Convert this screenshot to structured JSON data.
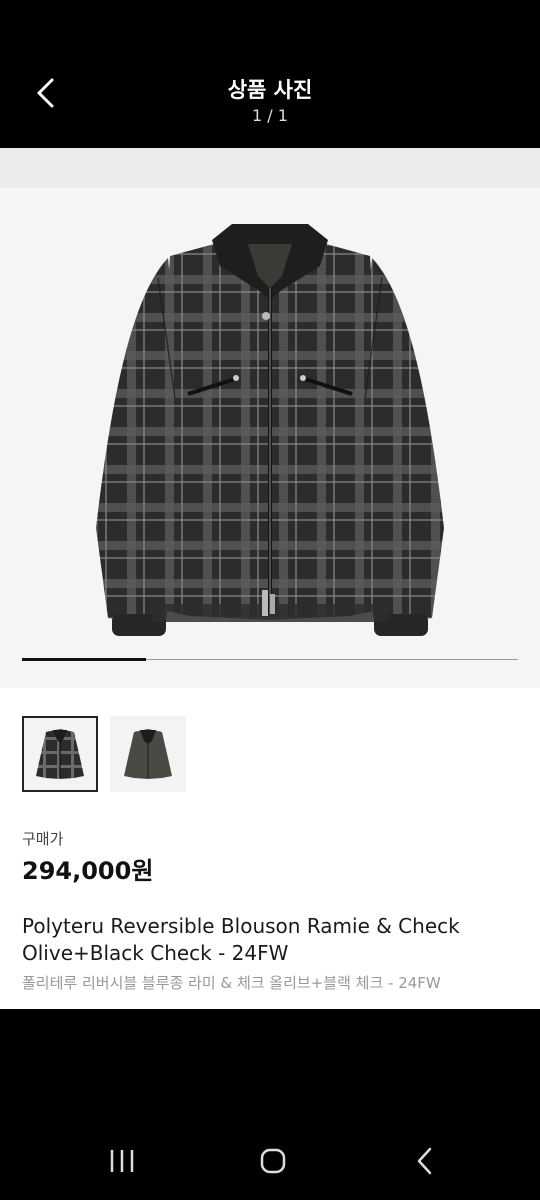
{
  "header": {
    "title": "상품 사진",
    "counter": "1 / 1"
  },
  "gallery": {
    "progress": 0.25
  },
  "thumbnails": [
    {
      "name": "plaid-jacket-thumbnail"
    },
    {
      "name": "olive-jacket-thumbnail"
    }
  ],
  "product": {
    "price_label": "구매가",
    "price": "294,000원",
    "name_en": "Polyteru Reversible Blouson Ramie & Check Olive+Black Check - 24FW",
    "name_ko": "폴리테루 리버시블 블루종 라미 & 체크 올리브+블랙 체크 - 24FW"
  },
  "colors": {
    "accent": "#111111",
    "muted": "#999999",
    "jacket_dark": "#2a2a2a",
    "jacket_grey": "#6a6a6a",
    "olive": "#4a4a44"
  },
  "system_nav": {
    "icons": [
      "recent-apps-icon",
      "home-icon",
      "back-icon"
    ]
  }
}
